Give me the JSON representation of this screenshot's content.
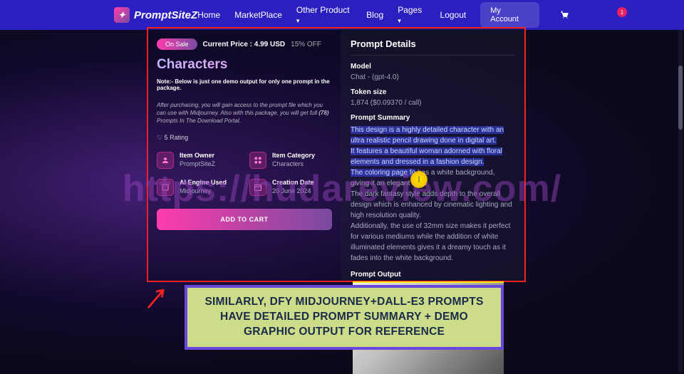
{
  "header": {
    "logo_text": "PromptSiteZ",
    "nav": {
      "home": "Home",
      "marketplace": "MarketPlace",
      "other": "Other Product",
      "blog": "Blog",
      "pages": "Pages",
      "logout": "Logout",
      "account": "My Account"
    },
    "notif": "1"
  },
  "product": {
    "sale_badge": "On Sale",
    "price_label": "Current Price : 4.99 USD",
    "discount": "15% OFF",
    "title": "Characters",
    "note": "Note:- Below is just one demo output for only one prompt in the package.",
    "desc_1": "After purchasing, you will gain access to the prompt file which you can use with Midjourney. Also with this package, you will get full ",
    "desc_bold": "(78)",
    "desc_2": " Prompts In The Download Portal.",
    "rating": "♡ 5 Rating",
    "info": {
      "owner_label": "Item Owner",
      "owner_value": "PromptSiteZ",
      "category_label": "Item Category",
      "category_value": "Characters",
      "engine_label": "AI Engine Used",
      "engine_value": "Midjourney",
      "date_label": "Creation Date",
      "date_value": "20 June 2024"
    },
    "add_cart": "ADD TO CART"
  },
  "details": {
    "heading": "Prompt Details",
    "model_label": "Model",
    "model_value": "Chat - (gpt-4.0)",
    "token_label": "Token size",
    "token_value": "1,874 ($0.09370 / call)",
    "summary_label": "Prompt Summary",
    "summary_hl_1": "This design is a highly detailed character with an ultra realistic pencil drawing done in digital art.",
    "summary_hl_2": "It features a beautiful woman adorned with floral elements and dressed in a fashion design.",
    "summary_hl_3a": "The coloring page fo",
    "summary_mix": "has a white background, giving it an elegant look.",
    "summary_plain_1": "The dark fantasy style adds depth to the overall design which is enhanced by cinematic lighting and high resolution quality.",
    "summary_plain_2": "Additionally, the use of 32mm size makes it perfect for various mediums while the addition of white illuminated elements gives it a dreamy touch as it fades into the white background.",
    "output_label": "Prompt Output"
  },
  "callout": "SIMILARLY, DFY MIDJOURNEY+DALL-E3 PROMPTS HAVE DETAILED PROMPT SUMMARY + DEMO GRAPHIC OUTPUT FOR REFERENCE",
  "watermark": "https://hudareview.com/"
}
